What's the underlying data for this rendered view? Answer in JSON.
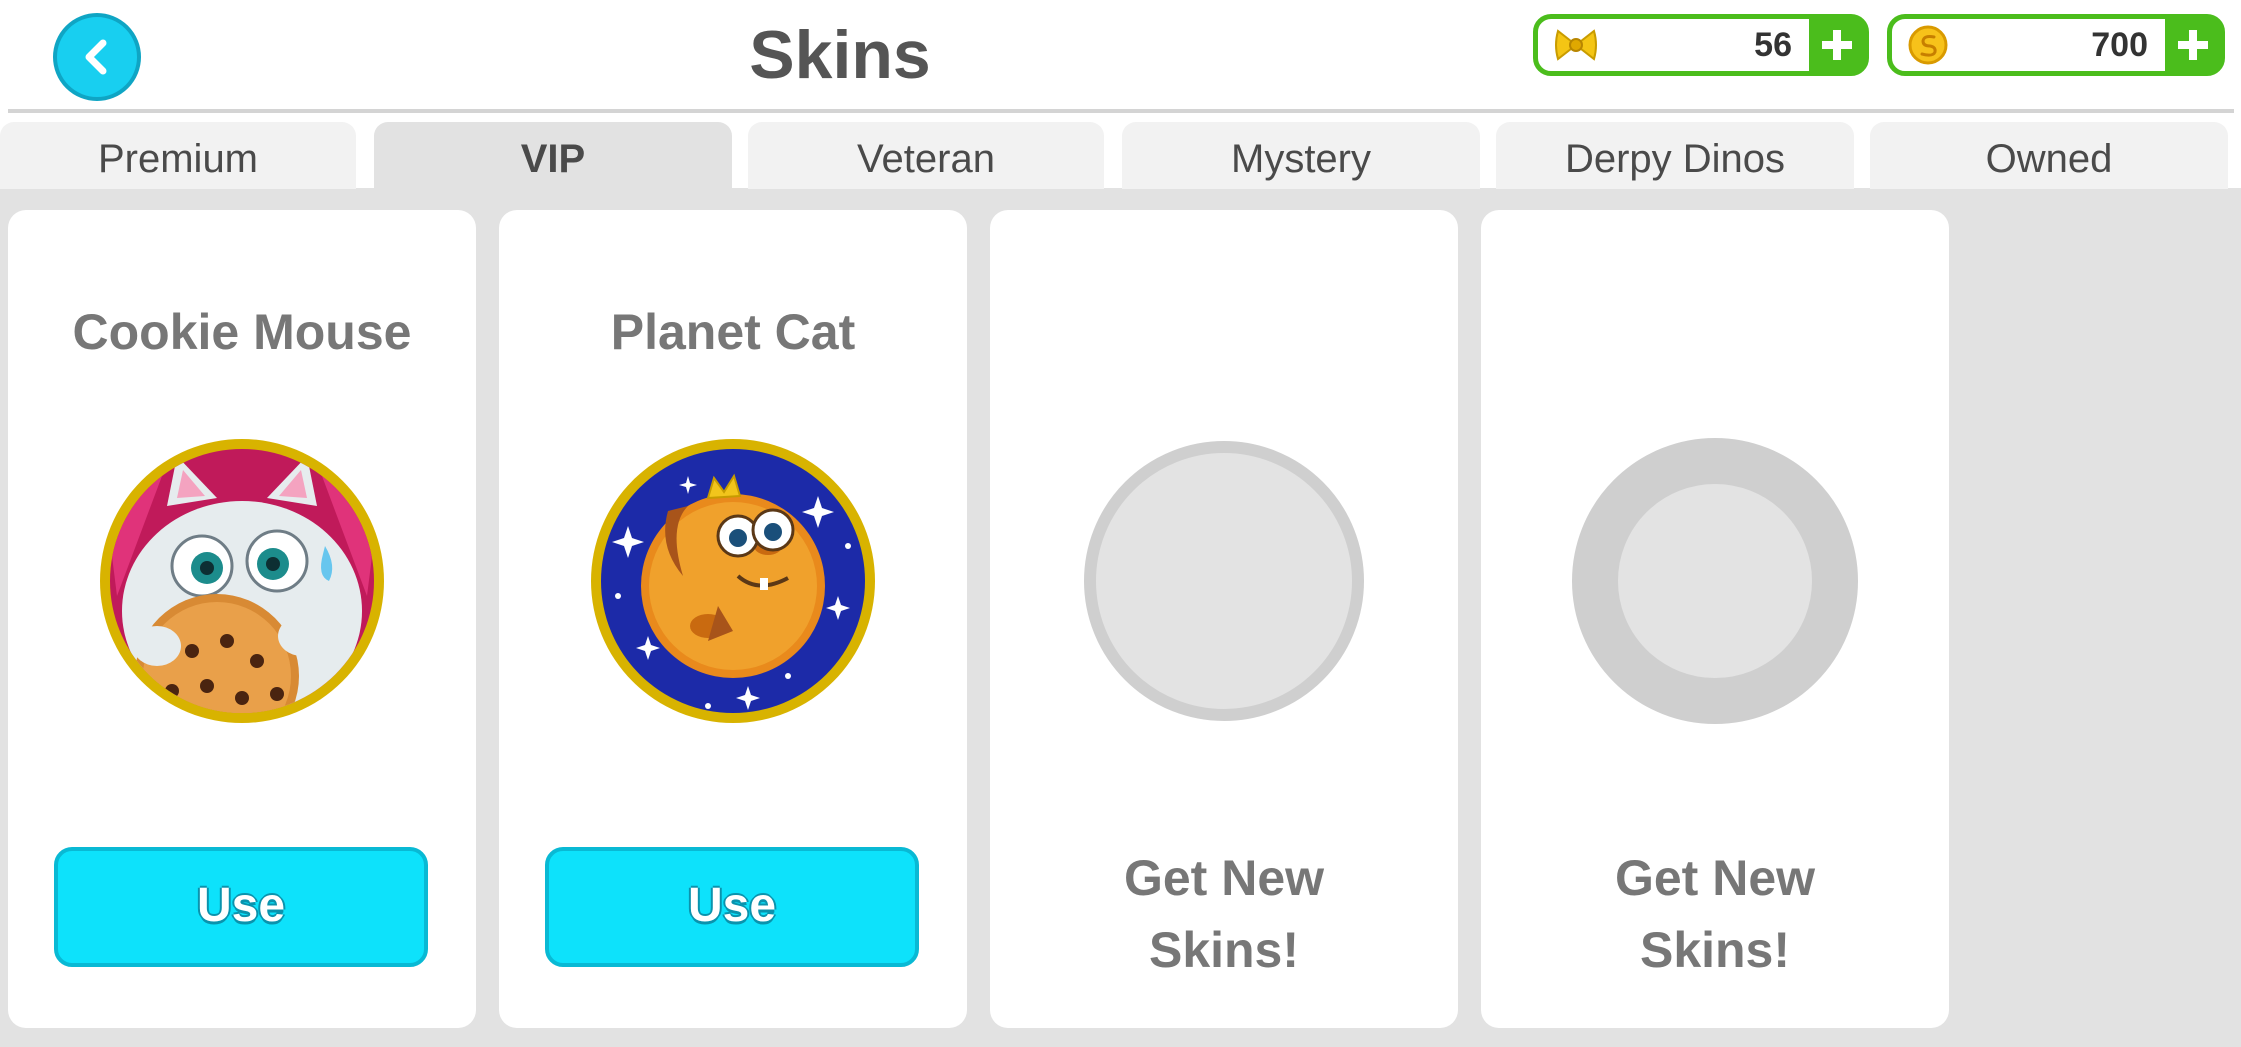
{
  "header": {
    "title": "Skins",
    "back_icon": "chevron-left-icon",
    "bows": {
      "icon": "bow-icon",
      "value": "56"
    },
    "coins": {
      "icon": "coin-icon",
      "value": "700"
    }
  },
  "tabs": [
    {
      "label": "Premium",
      "active": false
    },
    {
      "label": "VIP",
      "active": true
    },
    {
      "label": "Veteran",
      "active": false
    },
    {
      "label": "Mystery",
      "active": false
    },
    {
      "label": "Derpy Dinos",
      "active": false
    },
    {
      "label": "Owned",
      "active": false
    }
  ],
  "cards": [
    {
      "name": "Cookie Mouse",
      "image": "cookie-mouse-avatar",
      "button": "Use"
    },
    {
      "name": "Planet Cat",
      "image": "planet-cat-avatar",
      "button": "Use"
    },
    {
      "line1": "Get New",
      "line2": "Skins!"
    },
    {
      "line1": "Get New",
      "line2": "Skins!"
    }
  ],
  "colors": {
    "accent": "#0de2fb",
    "currency_green": "#4bbd1c",
    "title_gray": "#555555"
  }
}
